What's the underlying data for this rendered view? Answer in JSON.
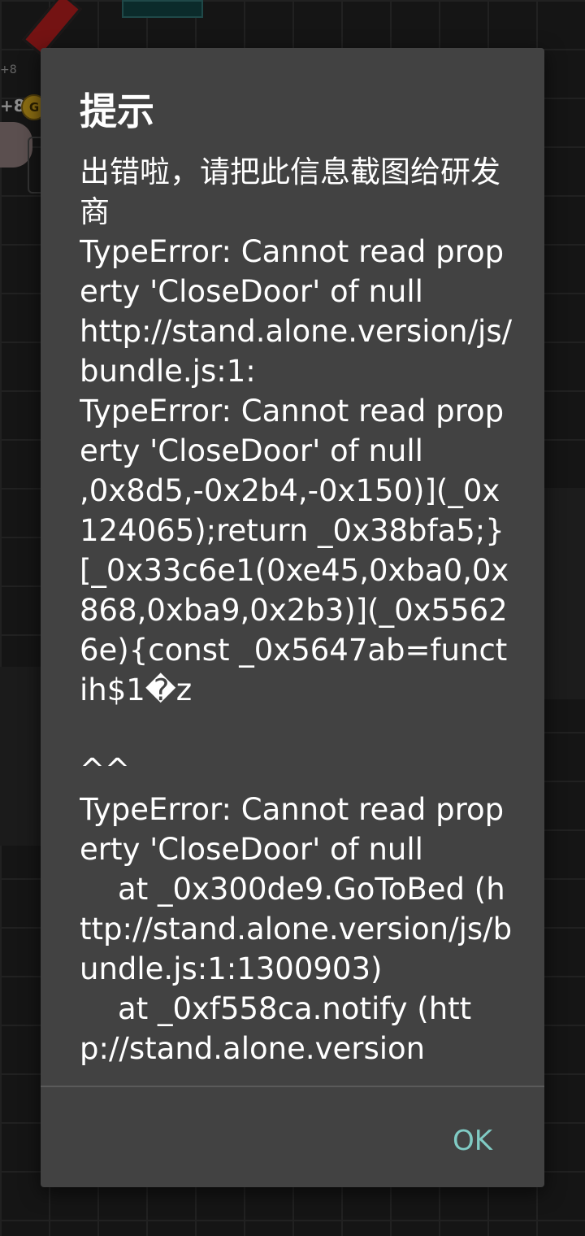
{
  "background": {
    "coin_label": "+8",
    "coin_letter": "G",
    "small_label": "+8"
  },
  "dialog": {
    "title": "提示",
    "message": "出错啦，请把此信息截图给研发商\nTypeError: Cannot read property 'CloseDoor' of null\nhttp://stand.alone.version/js/bundle.js:1:\nTypeError: Cannot read property 'CloseDoor' of null\n,0x8d5,-0x2b4,-0x150)](_0x124065);return _0x38bfa5;}[_0x33c6e1(0xe45,0xba0,0x868,0xba9,0x2b3)](_0x55626e){const _0x5647ab=functih$1�z\n\n^^\nTypeError: Cannot read property 'CloseDoor' of null\n    at _0x300de9.GoToBed (http://stand.alone.version/js/bundle.js:1:1300903)\n    at _0xf558ca.notify (http://stand.alone.version",
    "ok_label": "OK"
  },
  "colors": {
    "dialog_bg": "#424242",
    "accent": "#80cbc4",
    "text": "#ffffff"
  }
}
